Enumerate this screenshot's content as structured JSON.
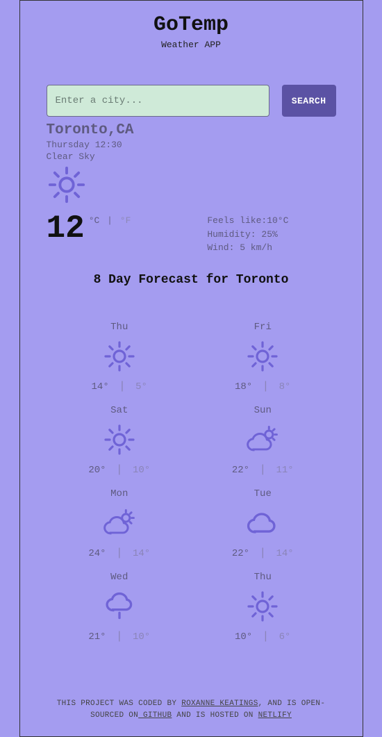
{
  "header": {
    "title": "GoTemp",
    "subtitle": "Weather APP"
  },
  "search": {
    "placeholder": "Enter a city...",
    "button": "SEARCH"
  },
  "location": {
    "name": "Toronto,CA",
    "datetime": "Thursday 12:30",
    "condition": "Clear Sky"
  },
  "current": {
    "temp": "12",
    "unit_c": "°C",
    "unit_f": "°F",
    "feels_like_label": "Feels like:",
    "feels_like_value": "10°C",
    "humidity_label": "Humidity:",
    "humidity_value": "25%",
    "wind_label": "Wind:",
    "wind_value": "5 km/h"
  },
  "forecast": {
    "title": "8 Day Forecast for Toronto",
    "days": [
      {
        "name": "Thu",
        "icon": "sun",
        "hi": "14°",
        "lo": "5°"
      },
      {
        "name": "Fri",
        "icon": "sun",
        "hi": "18°",
        "lo": "8°"
      },
      {
        "name": "Sat",
        "icon": "sun",
        "hi": "20°",
        "lo": "10°"
      },
      {
        "name": "Sun",
        "icon": "partly",
        "hi": "22°",
        "lo": "11°"
      },
      {
        "name": "Mon",
        "icon": "partly",
        "hi": "24°",
        "lo": "14°"
      },
      {
        "name": "Tue",
        "icon": "cloud",
        "hi": "22°",
        "lo": "14°"
      },
      {
        "name": "Wed",
        "icon": "rain",
        "hi": "21°",
        "lo": "10°"
      },
      {
        "name": "Thu",
        "icon": "sun",
        "hi": "10°",
        "lo": "6°"
      }
    ]
  },
  "footer": {
    "t1": "THIS PROJECT WAS CODED BY ",
    "author": "ROXANNE KEATINGS",
    "t2": ", AND IS OPEN-SOURCED ON",
    "github": " GITHUB",
    "t3": " AND IS HOSTED ON ",
    "netlify": "NETLIFY"
  }
}
